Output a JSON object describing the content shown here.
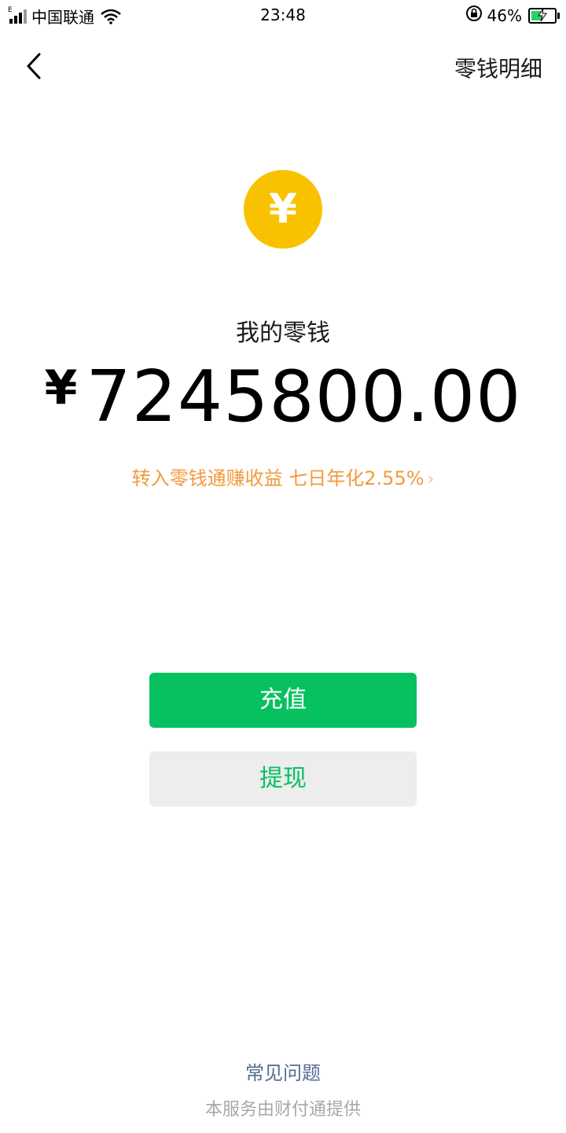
{
  "status_bar": {
    "network_type": "E",
    "carrier": "中国联通",
    "time": "23:48",
    "battery_percent": "46%",
    "battery_level": 0.46,
    "icons": [
      "signal-icon",
      "wifi-icon",
      "rotation-lock-icon",
      "battery-icon"
    ]
  },
  "nav": {
    "back_icon": "chevron-left-icon",
    "title_action": "零钱明细"
  },
  "wallet": {
    "coin_symbol": "¥",
    "label": "我的零钱",
    "currency": "¥",
    "amount": "7245800.00",
    "promo_text": "转入零钱通赚收益 七日年化2.55%",
    "promo_chevron": "›"
  },
  "actions": {
    "recharge_label": "充值",
    "withdraw_label": "提现"
  },
  "footer": {
    "faq_label": "常见问题",
    "provider_text": "本服务由财付通提供"
  },
  "colors": {
    "primary_green": "#07c160",
    "coin_yellow": "#f8c200",
    "promo_orange": "#f29a3b",
    "link_blue": "#586c94",
    "gray_button": "#ededed"
  }
}
